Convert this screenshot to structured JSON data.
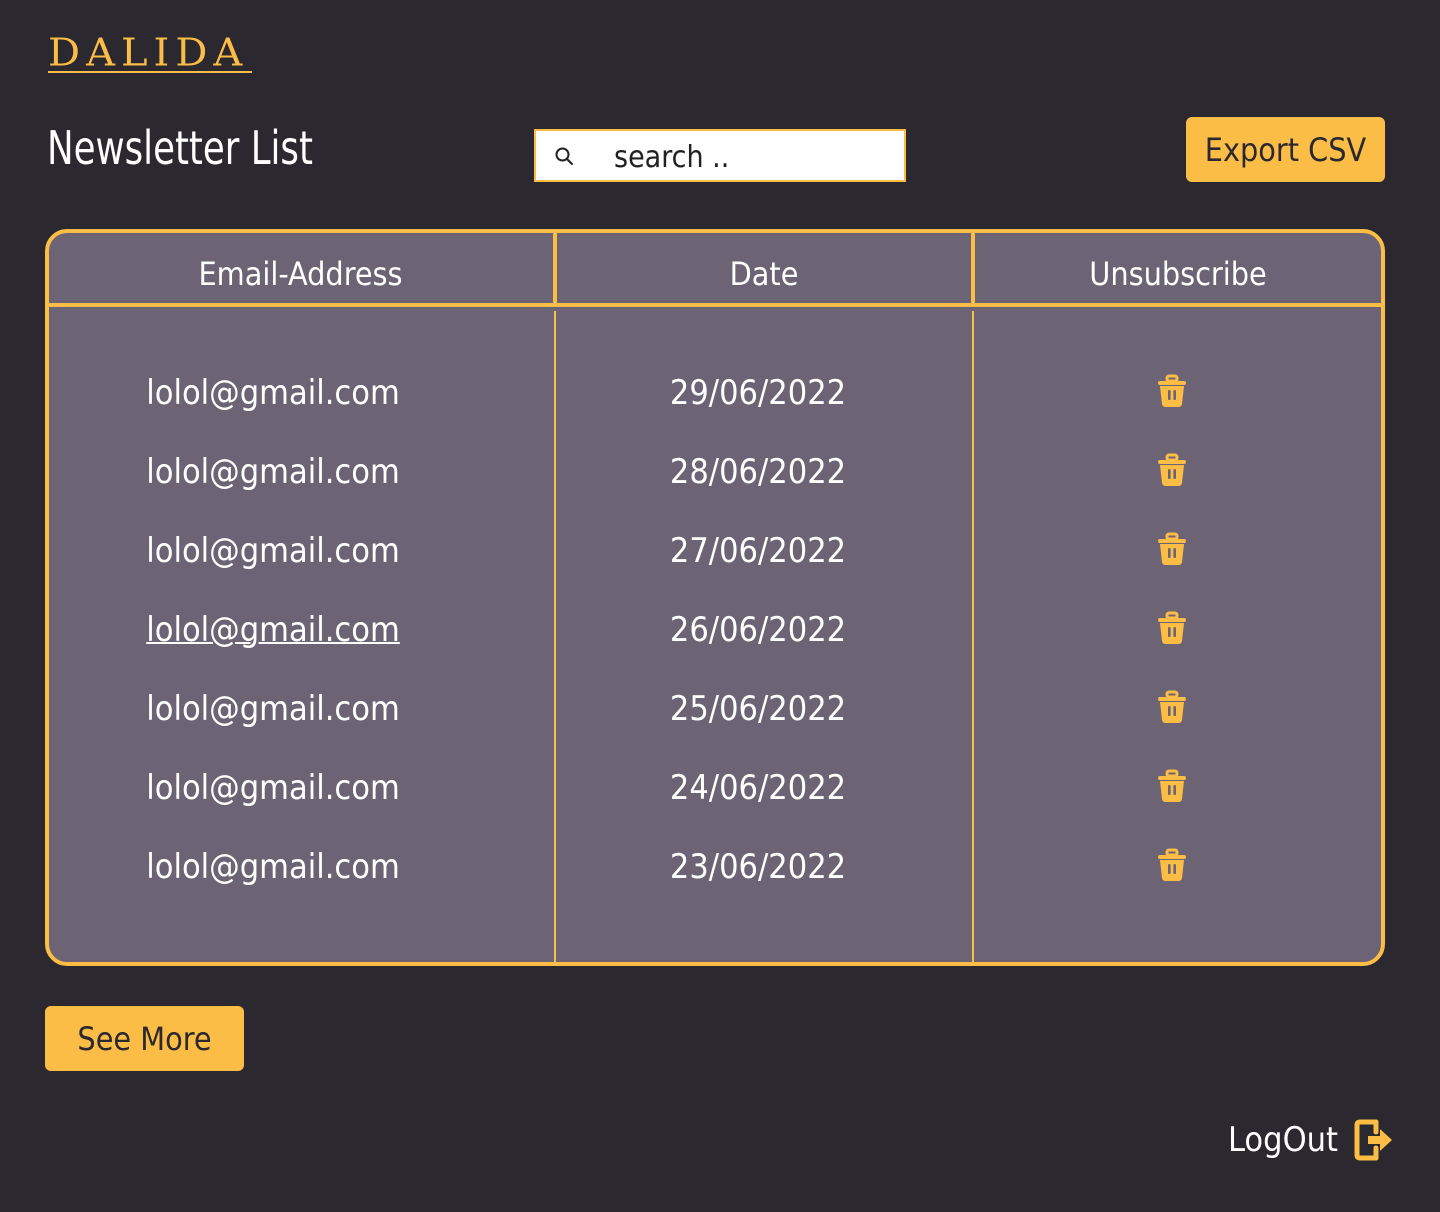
{
  "brand": {
    "logo_text": "DALIDA"
  },
  "header": {
    "title": "Newsletter List",
    "search_placeholder": "search ..",
    "export_label": "Export CSV"
  },
  "table": {
    "columns": [
      "Email-Address",
      "Date",
      "Unsubscribe"
    ],
    "rows": [
      {
        "email": "lolol@gmail.com",
        "date": "29/06/2022"
      },
      {
        "email": "lolol@gmail.com",
        "date": "28/06/2022"
      },
      {
        "email": "lolol@gmail.com",
        "date": "27/06/2022"
      },
      {
        "email": "lolol@gmail.com",
        "date": "26/06/2022"
      },
      {
        "email": "lolol@gmail.com",
        "date": "25/06/2022"
      },
      {
        "email": "lolol@gmail.com",
        "date": "24/06/2022"
      },
      {
        "email": "lolol@gmail.com",
        "date": "23/06/2022"
      }
    ],
    "action_icon": "trash-icon"
  },
  "footer": {
    "see_more_label": "See More",
    "logout_label": "LogOut",
    "logout_icon": "logout-icon"
  },
  "colors": {
    "background": "#2b2830",
    "accent": "#fbbd45",
    "table_bg": "#6c6474",
    "text": "#ffffff"
  }
}
